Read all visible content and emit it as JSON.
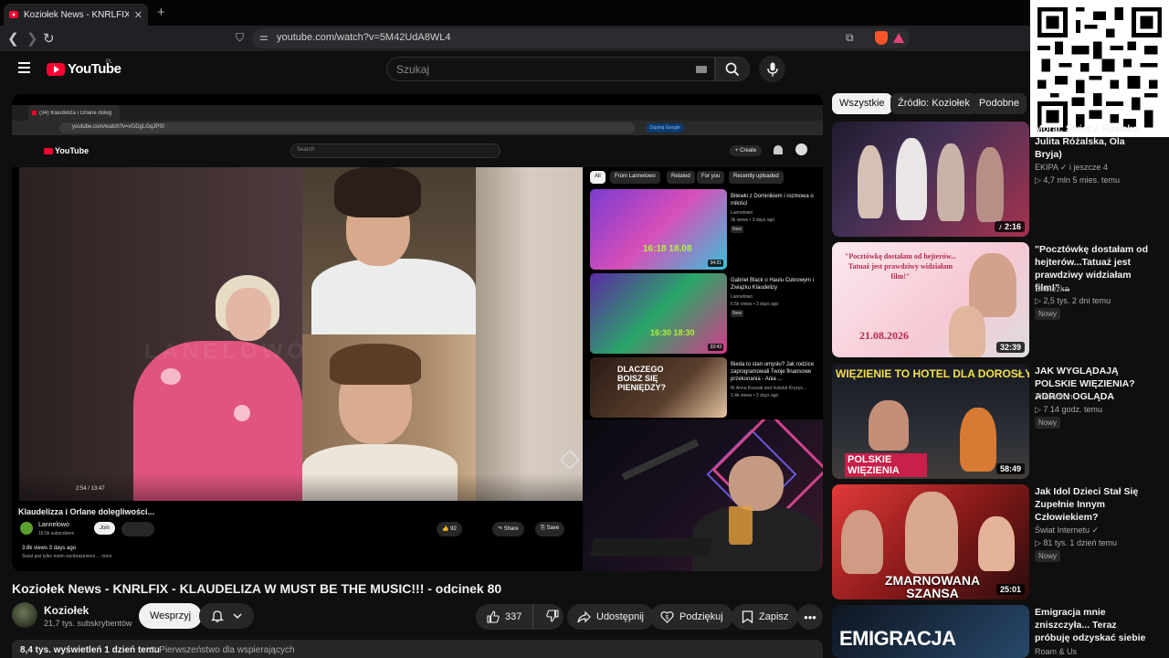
{
  "browser": {
    "tab_title": "Koziołek News - KNRLFIX - KLA",
    "url": "youtube.com/watch?v=5M42UdA8WL4"
  },
  "header": {
    "logo_text": "YouTube",
    "country": "PL",
    "search_placeholder": "Szukaj"
  },
  "embedded": {
    "tab_title": "(34) Klaudeliza i Orlane doleg",
    "url": "youtube.com/watch?v=vGDgLGqJPSI",
    "google_pill": "Zapytaj Google",
    "search_placeholder": "Search",
    "logo_text": "YouTube",
    "create_label": "+ Create",
    "time": "2:54 / 13:47",
    "watermark": "LANELOWO",
    "chips": [
      "All",
      "From Lannelowo",
      "Related",
      "For you",
      "Recently uploaded"
    ],
    "suggestions": [
      {
        "title": "Bitewki z Dominikiem i rozmowa o miłości",
        "channel": "Lannelowo",
        "meta": "3k views • 3 days ago",
        "badge": "New",
        "duration": "34:31",
        "thumb_text": "16:18 18.08"
      },
      {
        "title": "Gabriel Black o Haulu Cukrowym i Związku Klaudelizy",
        "channel": "Lannelowo",
        "meta": "6.5k views • 3 days ago",
        "badge": "New",
        "duration": "33:43",
        "thumb_text": "16:30 18:30"
      },
      {
        "title": "Bieda to stan umysłu? Jak rodzice zaprogramowali Twoje finansowe przekonania - Ania ...",
        "channel": "IK Anna Kossak and Instytut Kryzys...",
        "meta": "1.4k views • 3 days ago",
        "badge": "",
        "duration": "",
        "thumb_text": "DLACZEGO BOISZ SIĘ PIENIĘDZY?"
      }
    ],
    "video_title": "Klaudelizza i Orlane dolegliwości...",
    "channel": "Lannelowo",
    "subs": "16.5k subscribers",
    "join_label": "Join",
    "likes": "92",
    "share_label": "Share",
    "save_label": "Save",
    "views": "3.8k views  3 days ago",
    "desc": "Świat jest tylko moim wyobrażeniem ... more"
  },
  "video": {
    "title": "Koziołek News - KNRLFIX - KLAUDELIZA W MUST BE THE MUSIC!!! - odcinek 80",
    "channel": "Koziołek",
    "subscribers": "21,7 tys. subskrybentów",
    "support_label": "Wesprzyj",
    "likes": "337",
    "share_label": "Udostępnij",
    "thanks_label": "Podziękuj",
    "save_label": "Zapisz",
    "views": "8,4 tys. wyświetleń  1 dzień temu",
    "priority": "⊙ Pierwszeństwo dla wspierających"
  },
  "sidebar": {
    "chips": [
      "Wszystkie",
      "Źródło: Koziołek",
      "Podobne"
    ],
    "videos": [
      {
        "title": "Morai, Świeży, Fusiaka, Julita Różalska, Ola Bryja)",
        "channel": "EKIPA ✓ i jeszcze 4",
        "meta": "▷ 4,7 mln   5 mies. temu",
        "badge": "",
        "duration": "♪ 2:16",
        "thumb_text": ""
      },
      {
        "title": "\"Pocztówkę dostałam od hejterów...Tatuaż jest prawdziwy widziałam film!\" ...",
        "channel": "Shotezka",
        "meta": "▷ 2,5 tys.   2 dni temu",
        "badge": "Nowy",
        "duration": "32:39",
        "thumb_text": "\"Pocztówkę dostałam od hejterów... Tatuaż jest prawdziwy widziałam film!\"",
        "thumb_date": "21.08.2026"
      },
      {
        "title": "JAK WYGLĄDAJĄ POLSKIE WIĘZIENIA? ADRON OGLĄDA",
        "channel": "The Adron",
        "meta": "▷ 7   14 godz. temu",
        "badge": "Nowy",
        "duration": "58:49",
        "thumb_text": "WIĘZIENIE TO HOTEL DLA DOROSŁYCH",
        "thumb_text2": "POLSKIE WIĘZIENIA"
      },
      {
        "title": "Jak Idol Dzieci Stał Się Zupełnie Innym Człowiekiem?",
        "channel": "Świat Internetu ✓",
        "meta": "▷ 81 tys.   1 dzień temu",
        "badge": "Nowy",
        "duration": "25:01",
        "thumb_text": "ZMARNOWANA SZANSA"
      },
      {
        "title": "Emigracja mnie zniszczyła... Teraz próbuję odzyskać siebie",
        "channel": "Roam & Us",
        "meta": "",
        "badge": "",
        "duration": "",
        "thumb_text": "EMIGRACJA"
      }
    ]
  }
}
